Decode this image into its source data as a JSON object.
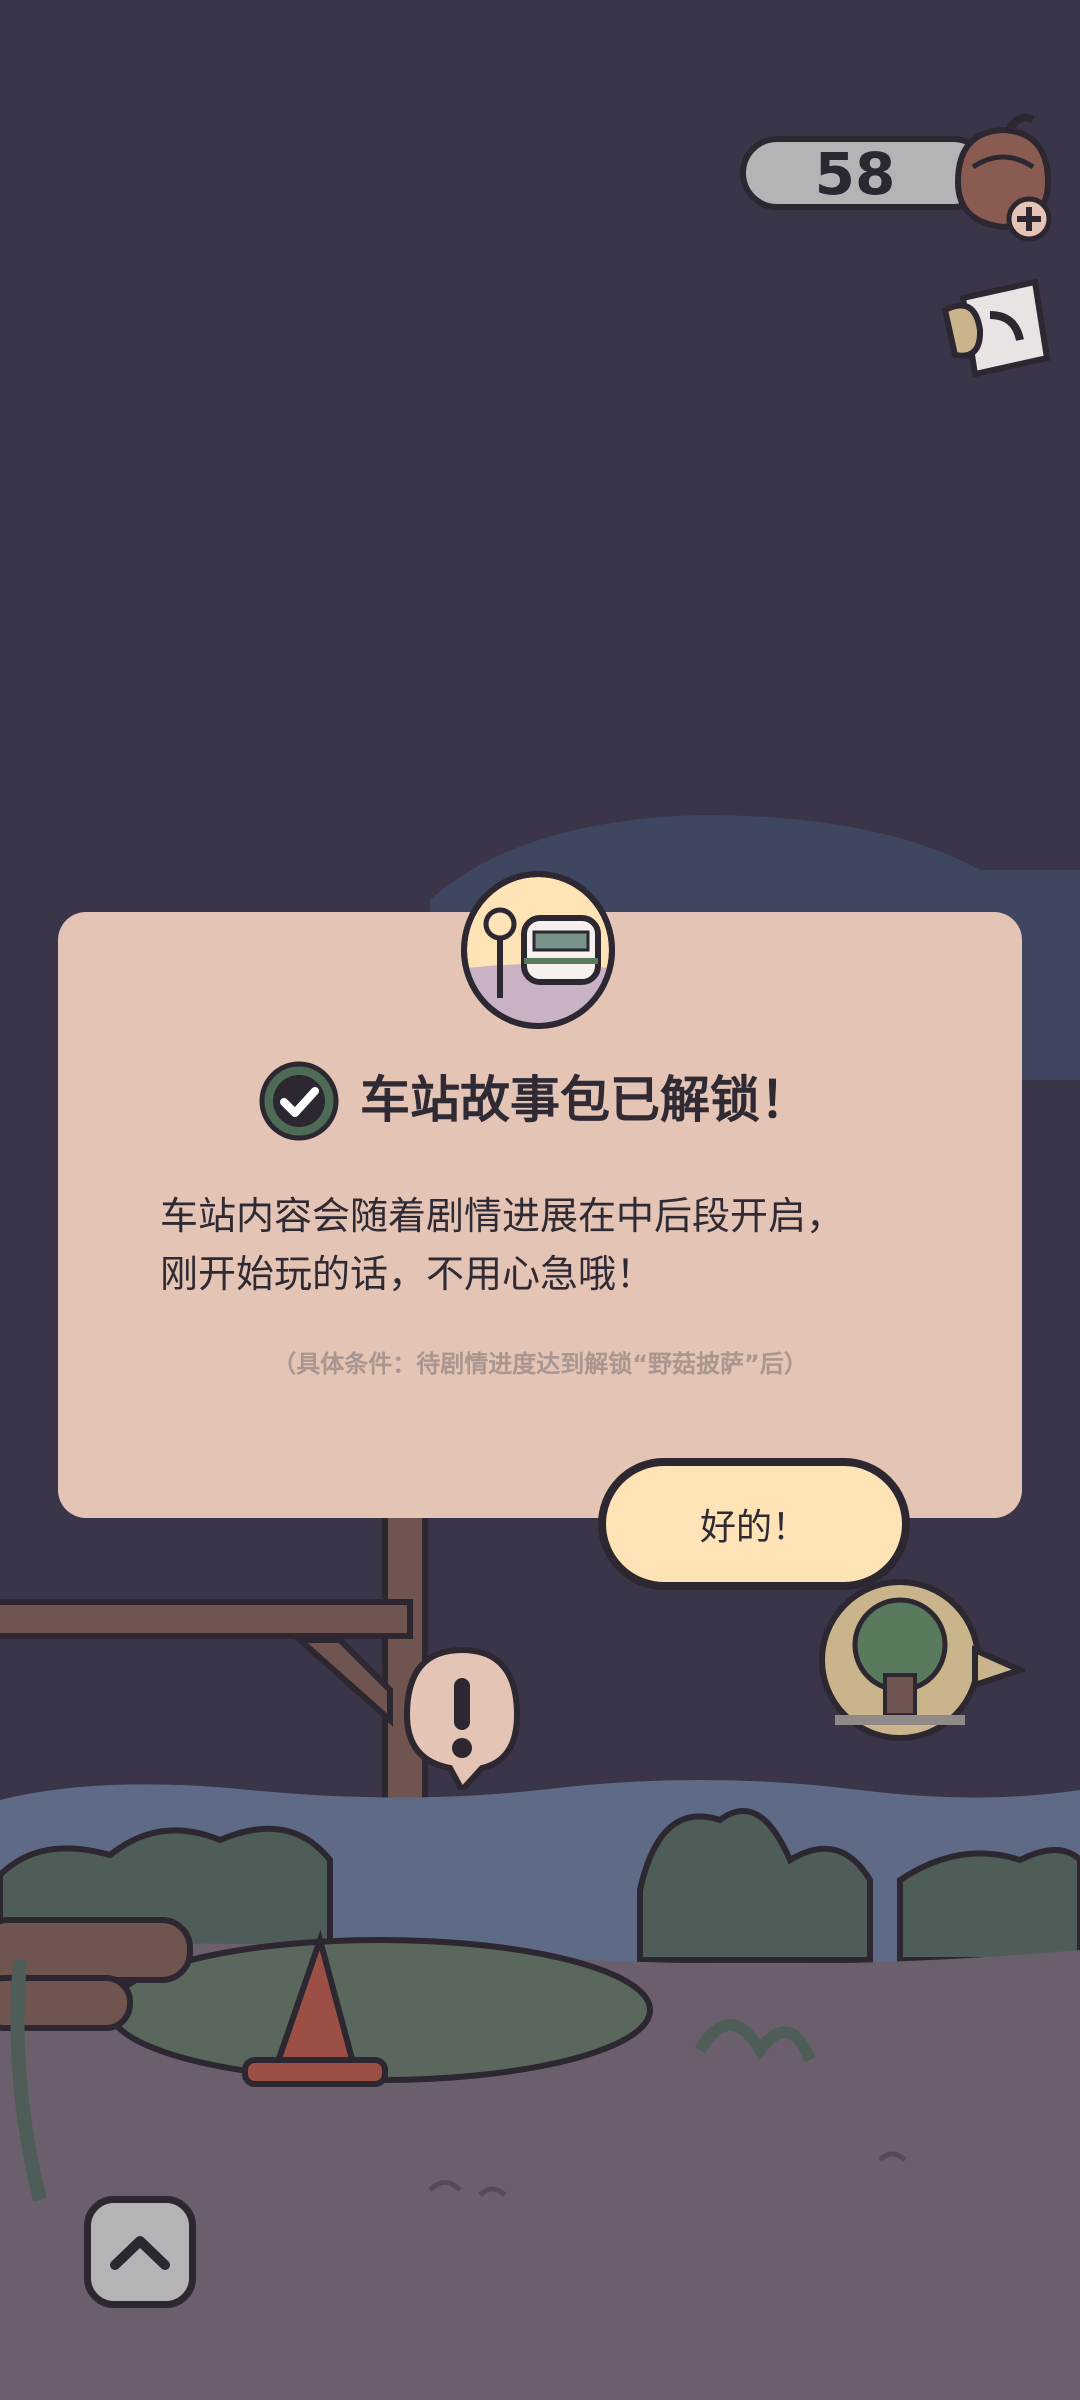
{
  "hud": {
    "currency_value": "58",
    "currency_icon": "acorn-icon",
    "add_icon": "plus-icon",
    "journal_icon": "journal-icon"
  },
  "dialog": {
    "badge_icon": "station-badge-icon",
    "check_icon": "check-circle-icon",
    "title": "车站故事包已解锁！",
    "body_line_1": "车站内容会随着剧情进展在中后段开启，",
    "body_line_2": "刚开始玩的话，不用心急哦！",
    "note": "（具体条件：待剧情进度达到解锁“野菇披萨”后）",
    "ok_label": "好的！"
  },
  "scene": {
    "alert_icon": "exclamation-icon",
    "tree_icon": "tree-house-icon",
    "up_icon": "chevron-up-icon"
  },
  "colors": {
    "night_sky": "#3a3548",
    "card": "#e3c4b5",
    "button": "#fde3b6",
    "outline": "#2c2730",
    "check_green": "#4e6b55"
  }
}
